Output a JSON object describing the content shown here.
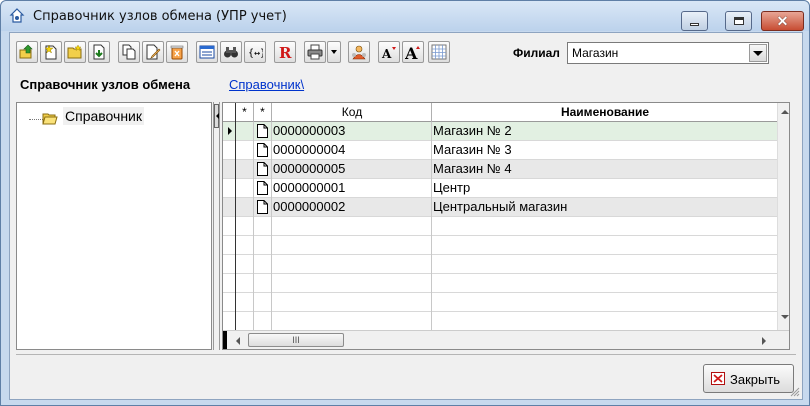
{
  "window": {
    "title": "Справочник узлов обмена (УПР учет)",
    "controls": [
      "minimize",
      "maximize",
      "close"
    ]
  },
  "toolbar": {
    "buttons": [
      {
        "icon": "go-up-folder-icon"
      },
      {
        "icon": "new-item-icon"
      },
      {
        "icon": "new-folder-icon"
      },
      {
        "icon": "save-icon"
      },
      {
        "icon": "copy-icon"
      },
      {
        "icon": "edit-icon"
      },
      {
        "icon": "delete-icon"
      },
      {
        "icon": "list-view-icon"
      },
      {
        "icon": "binoculars-icon"
      },
      {
        "icon": "hierarchy-icon"
      },
      {
        "icon": "report-r-icon"
      },
      {
        "icon": "printer-icon"
      },
      {
        "icon": "dropdown-arrow-icon"
      },
      {
        "icon": "refresh-person-icon"
      },
      {
        "icon": "font-decrease-icon"
      },
      {
        "icon": "font-increase-icon"
      },
      {
        "icon": "calculator-icon"
      }
    ],
    "filial_label": "Филиал",
    "filial_value": "Магазин"
  },
  "breadcrumb": {
    "title": "Справочник узлов обмена",
    "link": "Справочник\\"
  },
  "tree": {
    "root_label": "Справочник"
  },
  "grid": {
    "headers": {
      "star1": "*",
      "star2": "*",
      "code": "Код",
      "name": "Наименование"
    },
    "rows": [
      {
        "code": "0000000003",
        "name": "Магазин № 2",
        "selected": true
      },
      {
        "code": "0000000004",
        "name": "Магазин № 3",
        "selected": false
      },
      {
        "code": "0000000005",
        "name": "Магазин № 4",
        "selected": false
      },
      {
        "code": "0000000001",
        "name": "Центр",
        "selected": false
      },
      {
        "code": "0000000002",
        "name": "Центральный магазин",
        "selected": false
      }
    ],
    "empty_rows": 5,
    "scroll_thumb_label": "III"
  },
  "footer": {
    "close_label": "Закрыть"
  },
  "colors": {
    "selected_row": "#e2f0e2",
    "alt_row": "#e8e8e8",
    "link": "#0033cc",
    "titlebar": "#c7d9ee"
  }
}
